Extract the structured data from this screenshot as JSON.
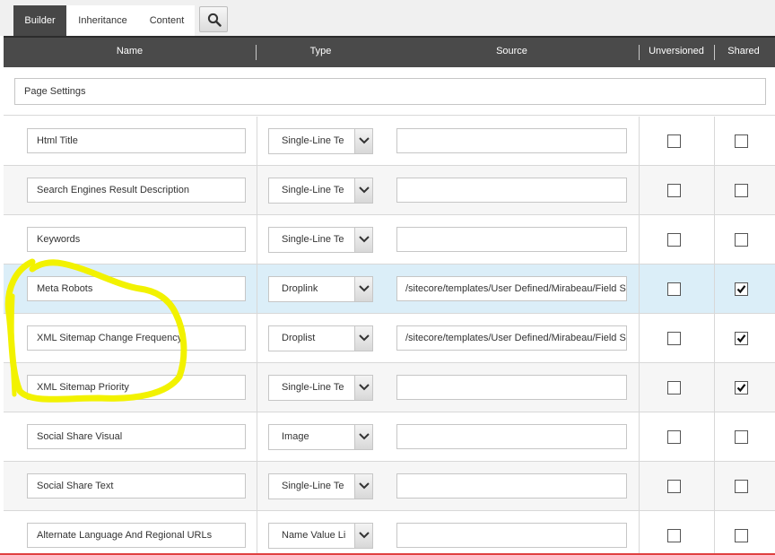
{
  "tabs": [
    {
      "label": "Builder",
      "active": true
    },
    {
      "label": "Inheritance",
      "active": false
    },
    {
      "label": "Content",
      "active": false
    }
  ],
  "search_icon": "search-icon",
  "columns": {
    "name": "Name",
    "type": "Type",
    "source": "Source",
    "unversioned": "Unversioned",
    "shared": "Shared"
  },
  "section": {
    "name": "Page Settings"
  },
  "fields": [
    {
      "name": "Html Title",
      "type": "Single-Line Te",
      "source": "",
      "unversioned": false,
      "shared": false,
      "selected": false
    },
    {
      "name": "Search Engines Result Description",
      "type": "Single-Line Te",
      "source": "",
      "unversioned": false,
      "shared": false,
      "selected": false
    },
    {
      "name": "Keywords",
      "type": "Single-Line Te",
      "source": "",
      "unversioned": false,
      "shared": false,
      "selected": false
    },
    {
      "name": "Meta Robots",
      "type": "Droplink",
      "source": "/sitecore/templates/User Defined/Mirabeau/Field S",
      "unversioned": false,
      "shared": true,
      "selected": true
    },
    {
      "name": "XML Sitemap Change Frequency",
      "type": "Droplist",
      "source": "/sitecore/templates/User Defined/Mirabeau/Field S",
      "unversioned": false,
      "shared": true,
      "selected": false
    },
    {
      "name": "XML Sitemap Priority",
      "type": "Single-Line Te",
      "source": "",
      "unversioned": false,
      "shared": true,
      "selected": false
    },
    {
      "name": "Social Share Visual",
      "type": "Image",
      "source": "",
      "unversioned": false,
      "shared": false,
      "selected": false
    },
    {
      "name": "Social Share Text",
      "type": "Single-Line Te",
      "source": "",
      "unversioned": false,
      "shared": false,
      "selected": false
    },
    {
      "name": "Alternate Language And Regional URLs",
      "type": "Name Value Li",
      "source": "",
      "unversioned": false,
      "shared": false,
      "selected": false
    }
  ],
  "colors": {
    "header_bg": "#4a4a4a",
    "active_tab": "#474747",
    "selected_row": "#dbeef8",
    "highlight_annotation": "#f2f200"
  }
}
